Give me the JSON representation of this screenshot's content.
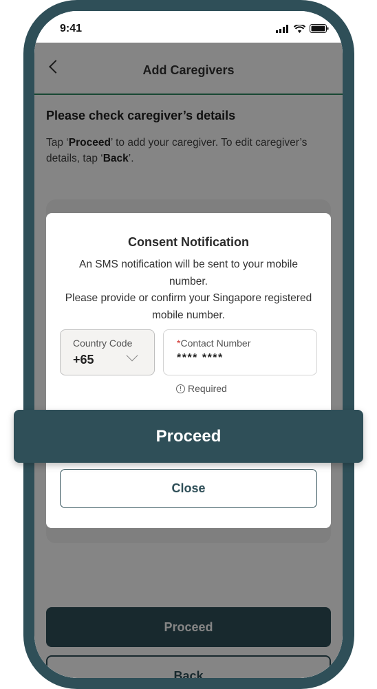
{
  "status_bar": {
    "time": "9:41",
    "icons": [
      "signal-icon",
      "wifi-icon",
      "battery-icon"
    ]
  },
  "header": {
    "title": "Add Caregivers",
    "back_icon": "chevron-left-icon"
  },
  "info": {
    "title": "Please check caregiver’s details",
    "line_pre": "Tap ‘",
    "proceed_word": "Proceed",
    "line_mid": "’ to add your caregiver. To edit caregiver’s details, tap ‘",
    "back_word": "Back",
    "line_end": "’."
  },
  "footer_buttons": {
    "proceed": "Proceed",
    "back": "Back"
  },
  "modal": {
    "title": "Consent Notification",
    "text_line1": "An SMS notification will be sent to your mobile number.",
    "text_line2": "Please provide or confirm your Singapore registered mobile number.",
    "country_code": {
      "label": "Country Code",
      "value": "+65"
    },
    "contact": {
      "required_mark": "*",
      "label": "Contact Number",
      "value": "**** ****"
    },
    "required_hint": "Required",
    "close_label": "Close"
  },
  "proceed_banner": "Proceed",
  "colors": {
    "primary": "#2f4f58",
    "accent_green": "#2f8a62",
    "required_red": "#d0312d"
  }
}
